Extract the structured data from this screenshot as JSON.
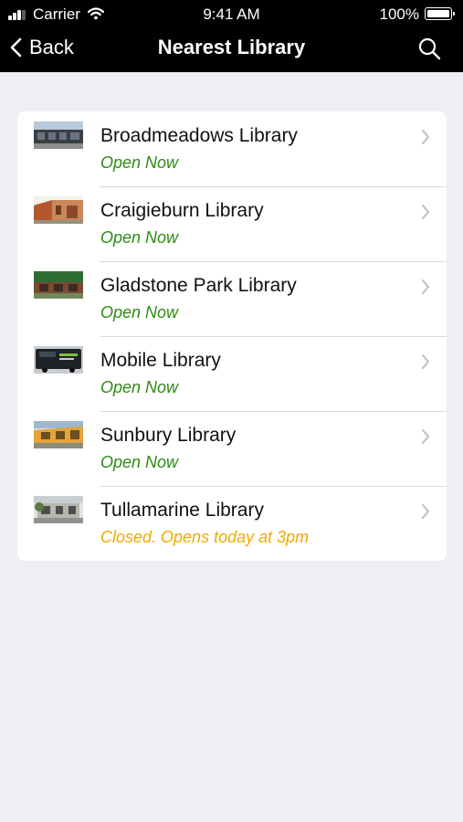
{
  "status_bar": {
    "carrier": "Carrier",
    "time": "9:41 AM",
    "battery": "100%",
    "icons": [
      "signal-icon",
      "wifi-icon",
      "battery-icon"
    ]
  },
  "nav": {
    "back_label": "Back",
    "title": "Nearest Library",
    "search_icon": "search-icon"
  },
  "colors": {
    "open": "#2e8b14",
    "closed": "#f0aa00",
    "background": "#eeeef3"
  },
  "libraries": [
    {
      "name": "Broadmeadows Library",
      "status": "Open Now",
      "state": "open"
    },
    {
      "name": "Craigieburn Library",
      "status": "Open Now",
      "state": "open"
    },
    {
      "name": "Gladstone Park Library",
      "status": "Open Now",
      "state": "open"
    },
    {
      "name": "Mobile Library",
      "status": "Open Now",
      "state": "open"
    },
    {
      "name": "Sunbury Library",
      "status": "Open Now",
      "state": "open"
    },
    {
      "name": "Tullamarine Library",
      "status": "Closed. Opens today at 3pm",
      "state": "closed"
    }
  ]
}
